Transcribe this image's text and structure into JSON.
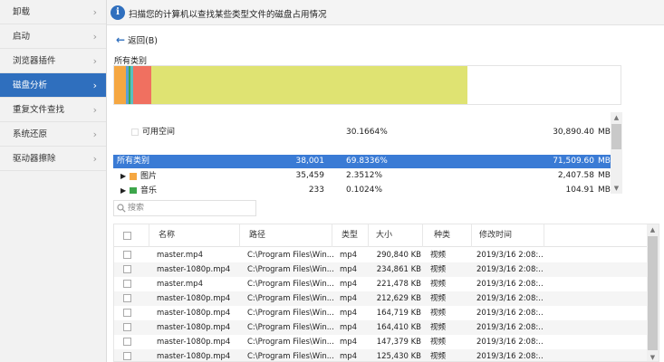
{
  "sidebar": {
    "items": [
      {
        "label": "卸载",
        "active": false
      },
      {
        "label": "启动",
        "active": false
      },
      {
        "label": "浏览器插件",
        "active": false
      },
      {
        "label": "磁盘分析",
        "active": true
      },
      {
        "label": "重复文件查找",
        "active": false
      },
      {
        "label": "系统还原",
        "active": false
      },
      {
        "label": "驱动器擦除",
        "active": false
      }
    ]
  },
  "banner": {
    "text": "扫描您的计算机以查找某些类型文件的磁盘占用情况"
  },
  "back": {
    "label": "返回(B)"
  },
  "usage": {
    "label": "所有类别",
    "segments": [
      {
        "name": "图片",
        "color": "#f5a742",
        "percent": 2.35
      },
      {
        "name": "",
        "color": "#5aa0d8",
        "percent": 0.6
      },
      {
        "name": "音乐",
        "color": "#3da64b",
        "percent": 0.3
      },
      {
        "name": "",
        "color": "#58c0c0",
        "percent": 0.6
      },
      {
        "name": "",
        "color": "#f07060",
        "percent": 3.5
      },
      {
        "name": "",
        "color": "#dfe372",
        "percent": 62.5
      }
    ]
  },
  "categories": {
    "free": {
      "name": "可用空间",
      "percent": "30.1664%",
      "size": "30,890.40",
      "unit": "MB"
    },
    "all": {
      "name": "所有类别",
      "count": "38,001",
      "percent": "69.8336%",
      "size": "71,509.60",
      "unit": "MB"
    },
    "pictures": {
      "name": "图片",
      "count": "35,459",
      "percent": "2.3512%",
      "size": "2,407.58",
      "unit": "MB",
      "color": "#f5a742"
    },
    "music": {
      "name": "音乐",
      "count": "233",
      "percent": "0.1024%",
      "size": "104.91",
      "unit": "MB",
      "color": "#3da64b"
    }
  },
  "search": {
    "placeholder": "搜索"
  },
  "table": {
    "headers": [
      "名称",
      "路径",
      "类型",
      "大小",
      "种类",
      "修改时间"
    ],
    "rows": [
      {
        "name": "master.mp4",
        "path": "C:\\Program Files\\Win...",
        "type": "mp4",
        "size": "290,840 KB",
        "kind": "视频",
        "modified": "2019/3/16 2:08:..."
      },
      {
        "name": "master-1080p.mp4",
        "path": "C:\\Program Files\\Win...",
        "type": "mp4",
        "size": "234,861 KB",
        "kind": "视频",
        "modified": "2019/3/16 2:08:..."
      },
      {
        "name": "master.mp4",
        "path": "C:\\Program Files\\Win...",
        "type": "mp4",
        "size": "221,478 KB",
        "kind": "视频",
        "modified": "2019/3/16 2:08:..."
      },
      {
        "name": "master-1080p.mp4",
        "path": "C:\\Program Files\\Win...",
        "type": "mp4",
        "size": "212,629 KB",
        "kind": "视频",
        "modified": "2019/3/16 2:08:..."
      },
      {
        "name": "master-1080p.mp4",
        "path": "C:\\Program Files\\Win...",
        "type": "mp4",
        "size": "164,719 KB",
        "kind": "视频",
        "modified": "2019/3/16 2:08:..."
      },
      {
        "name": "master-1080p.mp4",
        "path": "C:\\Program Files\\Win...",
        "type": "mp4",
        "size": "164,410 KB",
        "kind": "视频",
        "modified": "2019/3/16 2:08:..."
      },
      {
        "name": "master-1080p.mp4",
        "path": "C:\\Program Files\\Win...",
        "type": "mp4",
        "size": "147,379 KB",
        "kind": "视频",
        "modified": "2019/3/16 2:08:..."
      },
      {
        "name": "master-1080p.mp4",
        "path": "C:\\Program Files\\Win...",
        "type": "mp4",
        "size": "125,430 KB",
        "kind": "视频",
        "modified": "2019/3/16 2:08:..."
      }
    ]
  }
}
